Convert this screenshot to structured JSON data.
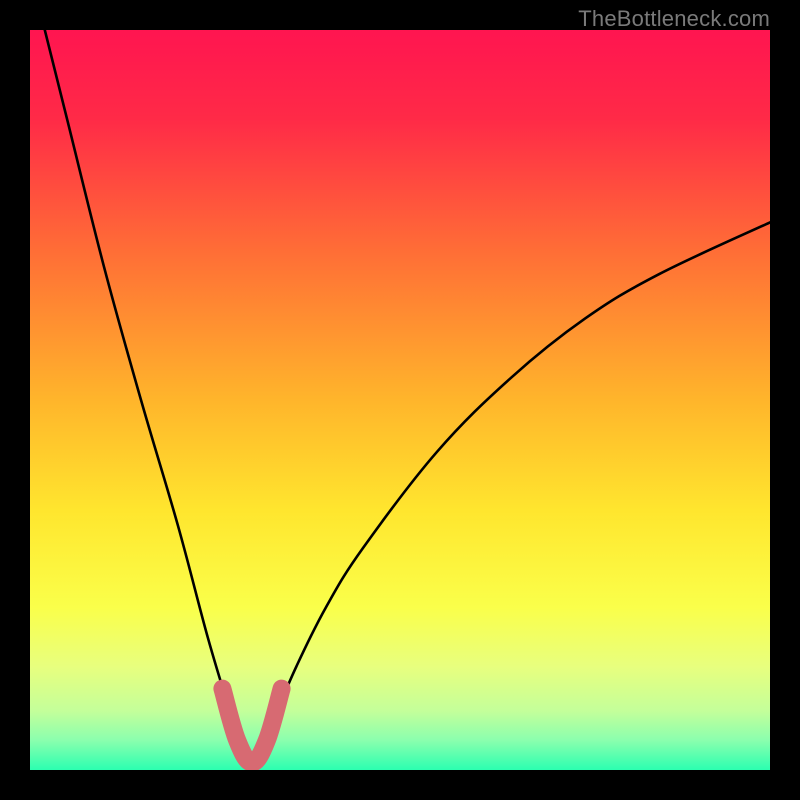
{
  "watermark": "TheBottleneck.com",
  "chart_data": {
    "type": "line",
    "title": "",
    "xlabel": "",
    "ylabel": "",
    "xlim": [
      0,
      100
    ],
    "ylim": [
      0,
      100
    ],
    "series": [
      {
        "name": "bottleneck-curve",
        "type": "line",
        "kind": "abs-deviation",
        "min_x": 30,
        "note": "V-shaped curve: steep left descent to a flat minimum near x≈30, asymptotic rise toward right.",
        "x": [
          2,
          5,
          10,
          15,
          20,
          24,
          27,
          29,
          30,
          31,
          33,
          36,
          40,
          45,
          55,
          65,
          75,
          85,
          100
        ],
        "values": [
          100,
          88,
          68,
          50,
          33,
          18,
          8,
          2,
          0,
          2,
          7,
          14,
          22,
          30,
          43,
          53,
          61,
          67,
          74
        ]
      },
      {
        "name": "highlight-band",
        "type": "line",
        "kind": "threshold-marker",
        "color": "#d76a72",
        "note": "Thick salmon U-shaped marker at the curve minimum (optimal region).",
        "x": [
          26,
          28,
          30,
          32,
          34
        ],
        "values": [
          11,
          4,
          1,
          4,
          11
        ]
      }
    ],
    "background": {
      "type": "vertical-gradient",
      "stops": [
        {
          "pos": 0.0,
          "color": "#ff1550"
        },
        {
          "pos": 0.12,
          "color": "#ff2a47"
        },
        {
          "pos": 0.3,
          "color": "#ff6e36"
        },
        {
          "pos": 0.5,
          "color": "#ffb52b"
        },
        {
          "pos": 0.65,
          "color": "#ffe62e"
        },
        {
          "pos": 0.78,
          "color": "#faff4a"
        },
        {
          "pos": 0.86,
          "color": "#e8ff7e"
        },
        {
          "pos": 0.92,
          "color": "#c4ff9a"
        },
        {
          "pos": 0.96,
          "color": "#8affae"
        },
        {
          "pos": 1.0,
          "color": "#2bffb0"
        }
      ]
    }
  }
}
